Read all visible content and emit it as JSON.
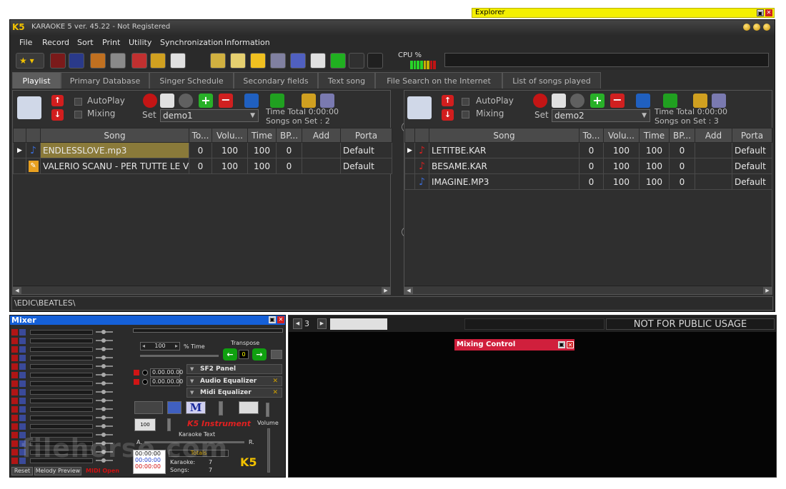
{
  "explorer": {
    "title": "Explorer"
  },
  "app": {
    "title": "KARAOKE 5  ver. 45.22 - Not Registered",
    "logo": "K5"
  },
  "menu": [
    "File",
    "Record",
    "Sort",
    "Print",
    "Utility",
    "Synchronization",
    "Information"
  ],
  "cpu": {
    "label": "CPU %"
  },
  "tabs": [
    "Playlist",
    "Primary Database",
    "Singer Schedule",
    "Secondary fields",
    "Text song",
    "File Search on the Internet",
    "List of songs played"
  ],
  "left": {
    "autoplay": "AutoPlay",
    "mixing": "Mixing",
    "set_label": "Set",
    "set_value": "demo1",
    "time_total": "Time Total  0:00:00",
    "songs_on_set": "Songs on Set : 2",
    "columns": [
      "Song",
      "To...",
      "Volu...",
      "Time",
      "BP...",
      "Add",
      "Porta"
    ],
    "rows": [
      {
        "song": "ENDLESSLOVE.mp3",
        "to": "0",
        "vol": "100",
        "time": "100",
        "bp": "0",
        "add": "",
        "porta": "Default"
      },
      {
        "song": "VALERIO SCANU - PER TUTTE LE VOLTE",
        "to": "0",
        "vol": "100",
        "time": "100",
        "bp": "0",
        "add": "",
        "porta": "Default"
      }
    ]
  },
  "right": {
    "autoplay": "AutoPlay",
    "mixing": "Mixing",
    "set_label": "Set",
    "set_value": "demo2",
    "time_total": "Time Total  0:00:00",
    "songs_on_set": "Songs on Set : 3",
    "columns": [
      "Song",
      "To...",
      "Volu...",
      "Time",
      "BP...",
      "Add",
      "Porta"
    ],
    "rows": [
      {
        "song": "LETITBE.KAR",
        "to": "0",
        "vol": "100",
        "time": "100",
        "bp": "0",
        "add": "",
        "porta": "Default"
      },
      {
        "song": "BESAME.KAR",
        "to": "0",
        "vol": "100",
        "time": "100",
        "bp": "0",
        "add": "",
        "porta": "Default"
      },
      {
        "song": "IMAGINE.MP3",
        "to": "0",
        "vol": "100",
        "time": "100",
        "bp": "0",
        "add": "",
        "porta": "Default"
      }
    ]
  },
  "status": {
    "path": "\\EDIC\\BEATLES\\"
  },
  "mixer": {
    "title": "Mixer",
    "tempo_value": "100",
    "time_label": "% Time",
    "transpose_label": "Transpose",
    "transpose_value": "0",
    "timer1": "0.00.00.00",
    "timer2": "0.00.00.00",
    "sf2": "SF2 Panel",
    "audio_eq": "Audio Equalizer",
    "midi_eq": "Midi Equalizer",
    "instrument": "K5 Instrument",
    "karaoke_text": "Karaoke Text",
    "volume": "Volume",
    "a": "A.",
    "r": "R.",
    "gauge": "100",
    "t1": "00:00:00",
    "t2": "00:00:00",
    "t3": "00:00:00",
    "totals": "Totals",
    "karaoke_label": "Karaoke:",
    "karaoke_count": "7",
    "songs_label": "Songs:",
    "songs_count": "7",
    "reset": "Reset",
    "melody": "Melody Preview",
    "midi_open": "MIDI Open",
    "logo": "K5"
  },
  "nav": {
    "page": "3",
    "notice": "NOT FOR PUBLIC USAGE"
  },
  "mixing_control": {
    "title": "Mixing Control"
  },
  "watermark": "filehorse.com"
}
